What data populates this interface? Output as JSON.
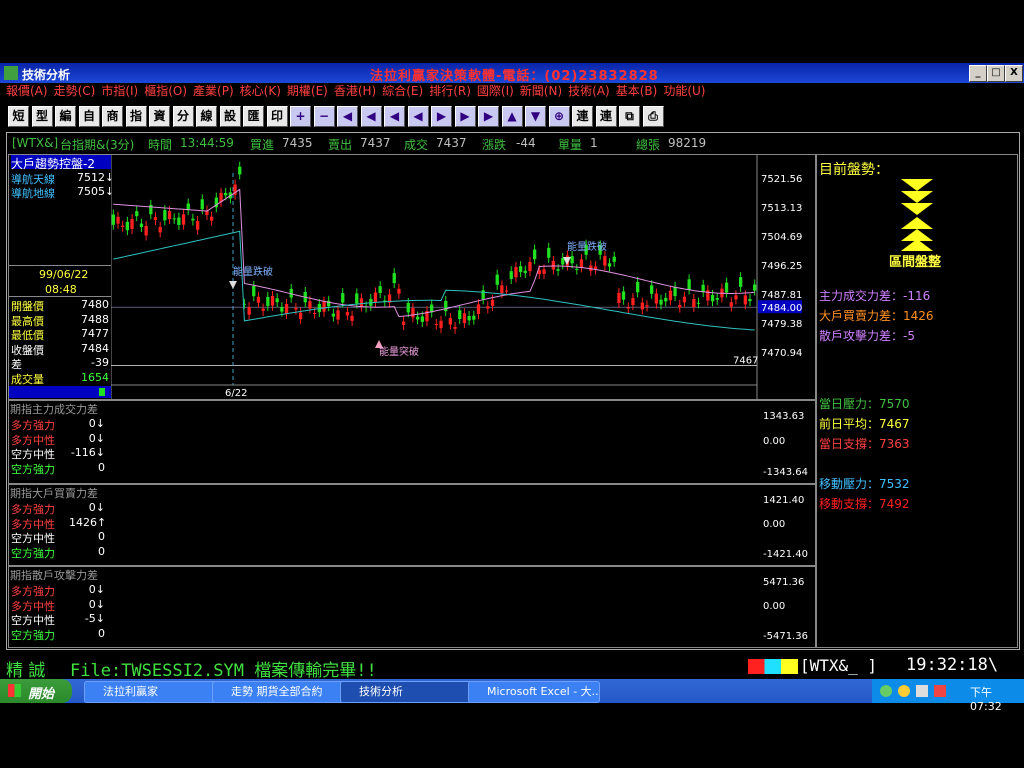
{
  "window": {
    "title": "技術分析",
    "center_title": "法拉利贏家決策軟體-電話：(02)23832828",
    "btn_min": "_",
    "btn_max": "□",
    "btn_close": "X"
  },
  "menu": [
    "報價(A)",
    "走勢(C)",
    "市指(I)",
    "櫃指(O)",
    "產業(P)",
    "核心(K)",
    "期權(E)",
    "香港(H)",
    "綜合(E)",
    "排行(R)",
    "國際(I)",
    "新聞(N)",
    "技術(A)",
    "基本(B)",
    "功能(U)"
  ],
  "toolbar": [
    "短",
    "型",
    "編",
    "自",
    "商",
    "指",
    "資",
    "分",
    "線",
    "設",
    "匯",
    "印",
    "+",
    "−",
    "◀",
    "◀",
    "◀",
    "◀",
    "▶",
    "▶",
    "▶",
    "▲",
    "▼",
    "⊕",
    "連",
    "連",
    "⧉",
    "⎙"
  ],
  "info": {
    "symbol": "[WTX&]",
    "name": "台指期&(3分)",
    "time_label": "時間",
    "time": "13:44:59",
    "buy_label": "買進",
    "buy": "7435",
    "sell_label": "賣出",
    "sell": "7437",
    "deal_label": "成交",
    "deal": "7437",
    "chg_label": "漲跌",
    "chg": "-44",
    "vol_label": "單量",
    "vol": "1",
    "total_label": "總張",
    "total": "98219"
  },
  "main": {
    "title": "大戶趨勢控盤-2",
    "nav_top_label": "導航天線",
    "nav_top": "7512↓",
    "nav_bot_label": "導航地線",
    "nav_bot": "7505↓",
    "date": "99/06/22",
    "time": "08:48",
    "quotes": [
      {
        "k": "開盤價",
        "v": "7480"
      },
      {
        "k": "最高價",
        "v": "7488"
      },
      {
        "k": "最低價",
        "v": "7477"
      },
      {
        "k": "收盤價",
        "v": "7484"
      },
      {
        "k": "差",
        "v": "-39"
      },
      {
        "k": "成交量",
        "v": "1654"
      }
    ],
    "axis": [
      "7521.56",
      "7513.13",
      "7504.69",
      "7496.25",
      "7487.81",
      "7479.38",
      "7470.94"
    ],
    "last_price": "7484.00",
    "low_mark": "7467",
    "date_mark": "6/22",
    "ann1": "能量跌破",
    "ann2": "能量跌破",
    "ann3": "能量突破"
  },
  "sub1": {
    "title": "期指主力成交力差",
    "rows": [
      {
        "k": "多方強力",
        "v": "0↓"
      },
      {
        "k": "多方中性",
        "v": "0↓"
      },
      {
        "k": "空方中性",
        "v": "-116↓"
      },
      {
        "k": "空方強力",
        "v": "0"
      }
    ],
    "axis": [
      "1343.63",
      "0.00",
      "-1343.64"
    ]
  },
  "sub2": {
    "title": "期指大戶買賣力差",
    "rows": [
      {
        "k": "多方強力",
        "v": "0↓"
      },
      {
        "k": "多方中性",
        "v": "1426↑"
      },
      {
        "k": "空方中性",
        "v": "0"
      },
      {
        "k": "空方強力",
        "v": "0"
      }
    ],
    "axis": [
      "1421.40",
      "0.00",
      "-1421.40"
    ]
  },
  "sub3": {
    "title": "期指散戶攻擊力差",
    "rows": [
      {
        "k": "多方強力",
        "v": "0↓"
      },
      {
        "k": "多方中性",
        "v": "0↓"
      },
      {
        "k": "空方中性",
        "v": "-5↓"
      },
      {
        "k": "空方強力",
        "v": "0"
      }
    ],
    "axis": [
      "5471.36",
      "0.00",
      "-5471.36"
    ]
  },
  "right": {
    "heading": "目前盤勢：",
    "trend": "區間盤整",
    "items": [
      {
        "k": "主力成交力差：",
        "v": "-116",
        "c": "#d080ff"
      },
      {
        "k": "大戶買賣力差：",
        "v": "1426",
        "c": "#ff9020"
      },
      {
        "k": "散戶攻擊力差：",
        "v": "-5",
        "c": "#d080ff"
      }
    ],
    "levels": [
      {
        "k": "當日壓力：",
        "v": "7570",
        "c": "#40c040"
      },
      {
        "k": "前日平均：",
        "v": "7467",
        "c": "#ffff40"
      },
      {
        "k": "當日支撐：",
        "v": "7363",
        "c": "#ff4040"
      },
      {
        "k": "移動壓力：",
        "v": "7532",
        "c": "#40c0ff"
      },
      {
        "k": "移動支撐：",
        "v": "7492",
        "c": "#ff2020"
      }
    ]
  },
  "status": {
    "left": "精  誠",
    "msg": "File:TWSESSI2.SYM  檔案傳輸完畢!!",
    "sym": "[WTX&_  ]",
    "clock": "19:32:18\\"
  },
  "taskbar": {
    "start": "開始",
    "tasks": [
      "法拉利贏家",
      "走勢 期貨全部合約",
      "技術分析",
      "Microsoft Excel - 大..."
    ],
    "clock": "下午 07:32"
  },
  "colors": {
    "up": "#ff2020",
    "down": "#20e020",
    "ma1": "#e090e0",
    "ma2": "#30c0c0"
  }
}
